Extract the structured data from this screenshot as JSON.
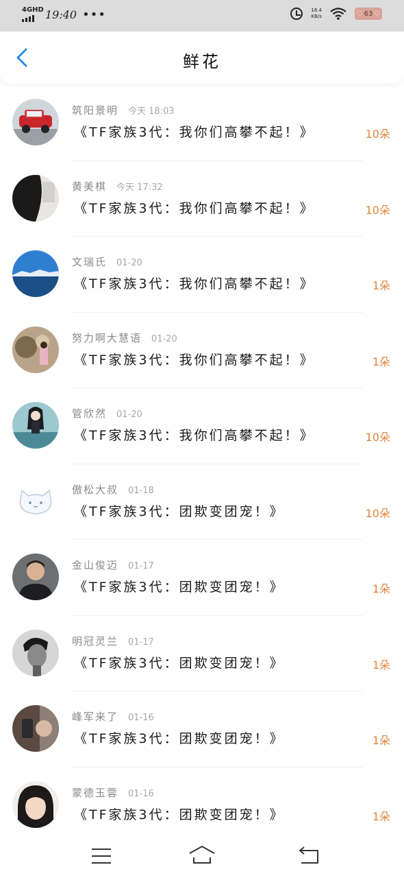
{
  "status_bar": {
    "network": "4GHD",
    "time": "19:40",
    "dots": "•••",
    "speed_top": "16.4",
    "speed_bottom": "KB/s",
    "battery": "63"
  },
  "header": {
    "title": "鲜花"
  },
  "list": [
    {
      "name": "筑阳景明",
      "time": "今天 18:03",
      "message": "《TF家族3代：我你们高攀不起！》",
      "count": "10朵",
      "avatar": "red-car-avatar"
    },
    {
      "name": "黄美棋",
      "time": "今天 17:32",
      "message": "《TF家族3代：我你们高攀不起！》",
      "count": "10朵",
      "avatar": "girl-hair-avatar"
    },
    {
      "name": "文瑞氏",
      "time": "01-20",
      "message": "《TF家族3代：我你们高攀不起！》",
      "count": "1朵",
      "avatar": "lake-avatar"
    },
    {
      "name": "努力啊大慧语",
      "time": "01-20",
      "message": "《TF家族3代：我你们高攀不起！》",
      "count": "1朵",
      "avatar": "flower-field-avatar"
    },
    {
      "name": "管欣然",
      "time": "01-20",
      "message": "《TF家族3代：我你们高攀不起！》",
      "count": "10朵",
      "avatar": "anime-girl-avatar"
    },
    {
      "name": "傲松大叔",
      "time": "01-18",
      "message": "《TF家族3代：团欺变团宠！》",
      "count": "10朵",
      "avatar": "cat-cartoon-avatar"
    },
    {
      "name": "金山俊迈",
      "time": "01-17",
      "message": "《TF家族3代：团欺变团宠！》",
      "count": "1朵",
      "avatar": "man-portrait-avatar"
    },
    {
      "name": "明冠灵兰",
      "time": "01-17",
      "message": "《TF家族3代：团欺变团宠！》",
      "count": "1朵",
      "avatar": "bw-man-avatar"
    },
    {
      "name": "峰军来了",
      "time": "01-16",
      "message": "《TF家族3代：团欺变团宠！》",
      "count": "1朵",
      "avatar": "mirror-selfie-avatar"
    },
    {
      "name": "蒙德玉蓉",
      "time": "01-16",
      "message": "《TF家族3代：团欺变团宠！》",
      "count": "1朵",
      "avatar": "girl-face-avatar"
    }
  ],
  "nav": {
    "menu_icon": "menu-icon",
    "home_icon": "home-icon",
    "back_icon": "back-icon"
  },
  "colors": {
    "accent_blue": "#2a8be8",
    "count_orange": "#e0843c"
  }
}
